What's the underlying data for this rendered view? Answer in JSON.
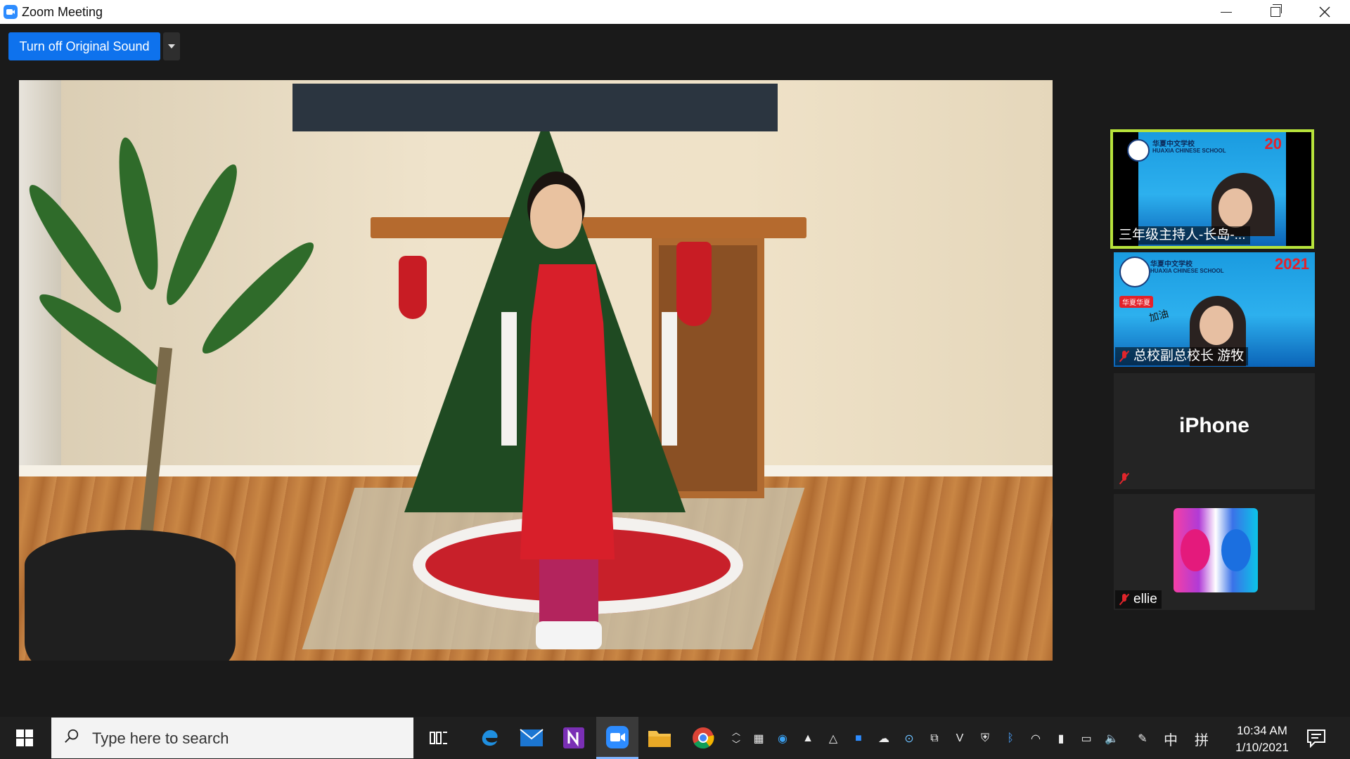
{
  "window": {
    "title": "Zoom Meeting",
    "controls": [
      "minimize",
      "restore",
      "close"
    ]
  },
  "toolbar": {
    "original_sound_label": "Turn off Original Sound"
  },
  "gallery": {
    "tiles": [
      {
        "label": "三年级主持人-长岛-...",
        "active_speaker": true,
        "banner_school": "华夏中文学校",
        "banner_school_en": "HUAXIA CHINESE SCHOOL",
        "banner_year": "20",
        "muted": false
      },
      {
        "label": "总校副总校长 游牧",
        "banner_school": "华夏中文学校",
        "banner_school_en": "HUAXIA CHINESE SCHOOL",
        "banner_year": "2021",
        "banner_cheer": "加油",
        "banner_tag": "华夏华夏",
        "muted": true
      },
      {
        "label": "iPhone",
        "muted": true
      },
      {
        "label": "ellie",
        "muted": true
      }
    ]
  },
  "taskbar": {
    "search_placeholder": "Type here to search",
    "apps": [
      "task-view",
      "edge",
      "mail",
      "onenote",
      "zoom",
      "file-explorer",
      "chrome"
    ],
    "active_app": "zoom",
    "ime_label": "中",
    "ime_mode": "拼",
    "time": "10:34 AM",
    "date": "1/10/2021"
  },
  "colors": {
    "zoom_blue": "#0E72ED",
    "active_speaker_border": "#b7e33b",
    "muted_red": "#e0252b",
    "meeting_background": "#1a1a1a"
  }
}
